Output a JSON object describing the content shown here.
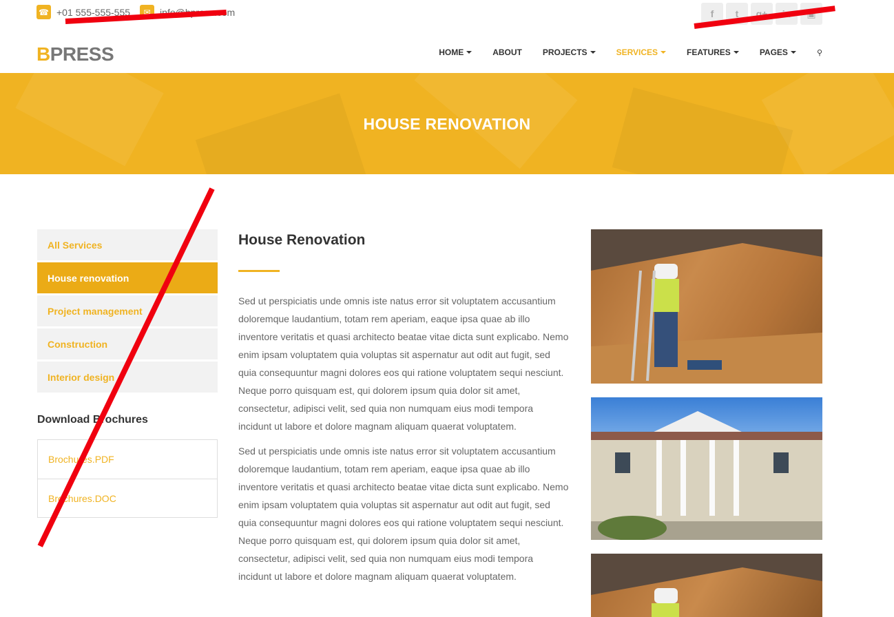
{
  "topbar": {
    "phone": "+01 555-555-555",
    "email": "info@bpress.com",
    "socials": [
      "facebook-icon",
      "twitter-icon",
      "google-plus-icon",
      "linkedin-icon",
      "instagram-icon"
    ]
  },
  "header": {
    "logo_accent": "B",
    "logo_rest": "PRESS",
    "nav": [
      {
        "label": "HOME",
        "dropdown": true
      },
      {
        "label": "ABOUT",
        "dropdown": false
      },
      {
        "label": "PROJECTS",
        "dropdown": true
      },
      {
        "label": "SERVICES",
        "dropdown": true
      },
      {
        "label": "FEATURES",
        "dropdown": true
      },
      {
        "label": "PAGES",
        "dropdown": true
      }
    ],
    "active_nav": "SERVICES"
  },
  "banner": {
    "title": "HOUSE RENOVATION"
  },
  "sidebar": {
    "items": [
      {
        "label": "All Services"
      },
      {
        "label": "House renovation"
      },
      {
        "label": "Project management"
      },
      {
        "label": "Construction"
      },
      {
        "label": "Interior design"
      }
    ],
    "active_item": "House renovation",
    "brochures_title": "Download Brochures",
    "brochures": [
      {
        "label": "Brochures.PDF"
      },
      {
        "label": "Brochures.DOC"
      }
    ]
  },
  "content": {
    "title": "House Renovation",
    "paragraphs": [
      "Sed ut perspiciatis unde omnis iste natus error sit voluptatem accusantium doloremque laudantium, totam rem aperiam, eaque ipsa quae ab illo inventore veritatis et quasi architecto beatae vitae dicta sunt explicabo. Nemo enim ipsam voluptatem quia voluptas sit aspernatur aut odit aut fugit, sed quia consequuntur magni dolores eos qui ratione voluptatem sequi nesciunt. Neque porro quisquam est, qui dolorem ipsum quia dolor sit amet, consectetur, adipisci velit, sed quia non numquam eius modi tempora incidunt ut labore et dolore magnam aliquam quaerat voluptatem.",
      "Sed ut perspiciatis unde omnis iste natus error sit voluptatem accusantium doloremque laudantium, totam rem aperiam, eaque ipsa quae ab illo inventore veritatis et quasi architecto beatae vitae dicta sunt explicabo. Nemo enim ipsam voluptatem quia voluptas sit aspernatur aut odit aut fugit, sed quia consequuntur magni dolores eos qui ratione voluptatem sequi nesciunt. Neque porro quisquam est, qui dolorem ipsum quia dolor sit amet, consectetur, adipisci velit, sed quia non numquam eius modi tempora incidunt ut labore et dolore magnam aliquam quaerat voluptatem."
    ]
  },
  "colors": {
    "accent": "#f0b322",
    "accent_dark": "#ebab16",
    "redaction": "#f0000f"
  }
}
